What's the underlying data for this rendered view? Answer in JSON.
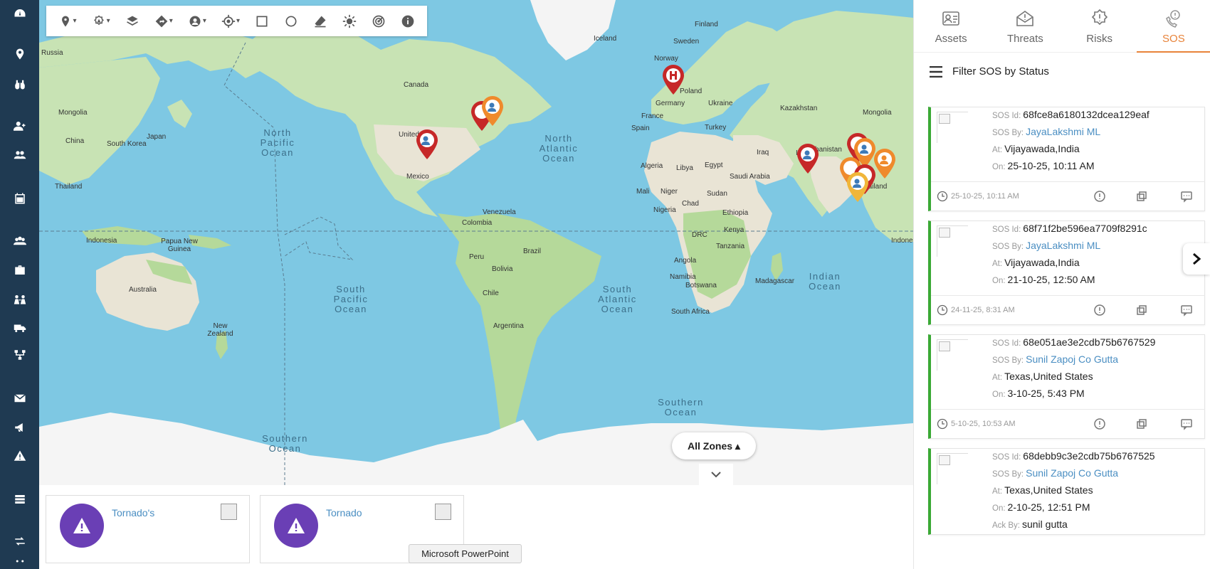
{
  "toolbar": {
    "tools": [
      "location-pin-tool",
      "threat-layer-tool",
      "layers-tool",
      "directions-tool",
      "person-filter-tool",
      "crosshair-tool",
      "rectangle-draw-tool",
      "circle-draw-tool",
      "eraser-tool",
      "brightness-tool",
      "radar-tool",
      "info-tool"
    ]
  },
  "map": {
    "countries": [
      "Russia",
      "Mongolia",
      "China",
      "South Korea",
      "Japan",
      "Thailand",
      "Indonesia",
      "Papua New Guinea",
      "Australia",
      "New Zealand",
      "Canada",
      "United",
      "Mexico",
      "Venezuela",
      "Colombia",
      "Peru",
      "Brazil",
      "Bolivia",
      "Chile",
      "Argentina",
      "Iceland",
      "Finland",
      "Sweden",
      "Norway",
      "Poland",
      "Germany",
      "Ukraine",
      "France",
      "Spain",
      "Turkey",
      "Kazakhstan",
      "Mongolia",
      "Afghanistan",
      "Iraq",
      "Iran",
      "Saudi Arabia",
      "Algeria",
      "Libya",
      "Egypt",
      "Mali",
      "Niger",
      "Chad",
      "Sudan",
      "Nigeria",
      "Ethiopia",
      "DRC",
      "Kenya",
      "Tanzania",
      "Angola",
      "Namibia",
      "Botswana",
      "Madagascar",
      "South Africa",
      "Thailand",
      "Indone"
    ],
    "oceans": {
      "north_pacific": "North Pacific Ocean",
      "north_atlantic": "North Atlantic Ocean",
      "south_pacific": "South Pacific Ocean",
      "south_atlantic": "South Atlantic Ocean",
      "indian": "Indian Ocean",
      "southern_1": "Southern Ocean",
      "southern_2": "Southern Ocean"
    },
    "zones_label": "All Zones ▴"
  },
  "alerts": [
    {
      "title": "Tornado's"
    },
    {
      "title": "Tornado"
    }
  ],
  "tooltip": "Microsoft PowerPoint",
  "tabs": [
    {
      "label": "Assets"
    },
    {
      "label": "Threats"
    },
    {
      "label": "Risks"
    },
    {
      "label": "SOS"
    }
  ],
  "filter_label": "Filter SOS by Status",
  "labels": {
    "sos_id": "SOS Id:",
    "sos_by": "SOS By:",
    "at": "At:",
    "on": "On:",
    "ack_by": "Ack By:"
  },
  "sos_cards": [
    {
      "id": "68fce8a6180132dcea129eaf",
      "by": "JayaLakshmi ML",
      "at": "Vijayawada,India",
      "on": "25-10-25, 10:11 AM",
      "footer_time": "25-10-25, 10:11 AM"
    },
    {
      "id": "68f71f2be596ea7709f8291c",
      "by": "JayaLakshmi ML",
      "at": "Vijayawada,India",
      "on": "21-10-25, 12:50 AM",
      "footer_time": "24-11-25, 8:31 AM"
    },
    {
      "id": "68e051ae3e2cdb75b6767529",
      "by": "Sunil Zapoj Co Gutta",
      "at": "Texas,United States",
      "on": "3-10-25, 5:43 PM",
      "footer_time": "5-10-25, 10:53 AM"
    },
    {
      "id": "68debb9c3e2cdb75b6767525",
      "by": "Sunil Zapoj Co Gutta",
      "at": "Texas,United States",
      "on": "2-10-25, 12:51 PM",
      "ack_by": "sunil gutta"
    }
  ],
  "colors": {
    "nav": "#1f3a52",
    "accent": "#e8833a",
    "status_green": "#3aa935",
    "alert_purple": "#6a3fb5",
    "link": "#4a8ec2",
    "pin_red": "#c62828",
    "pin_orange": "#ef8a2c",
    "pin_yellow": "#f0b63a"
  }
}
